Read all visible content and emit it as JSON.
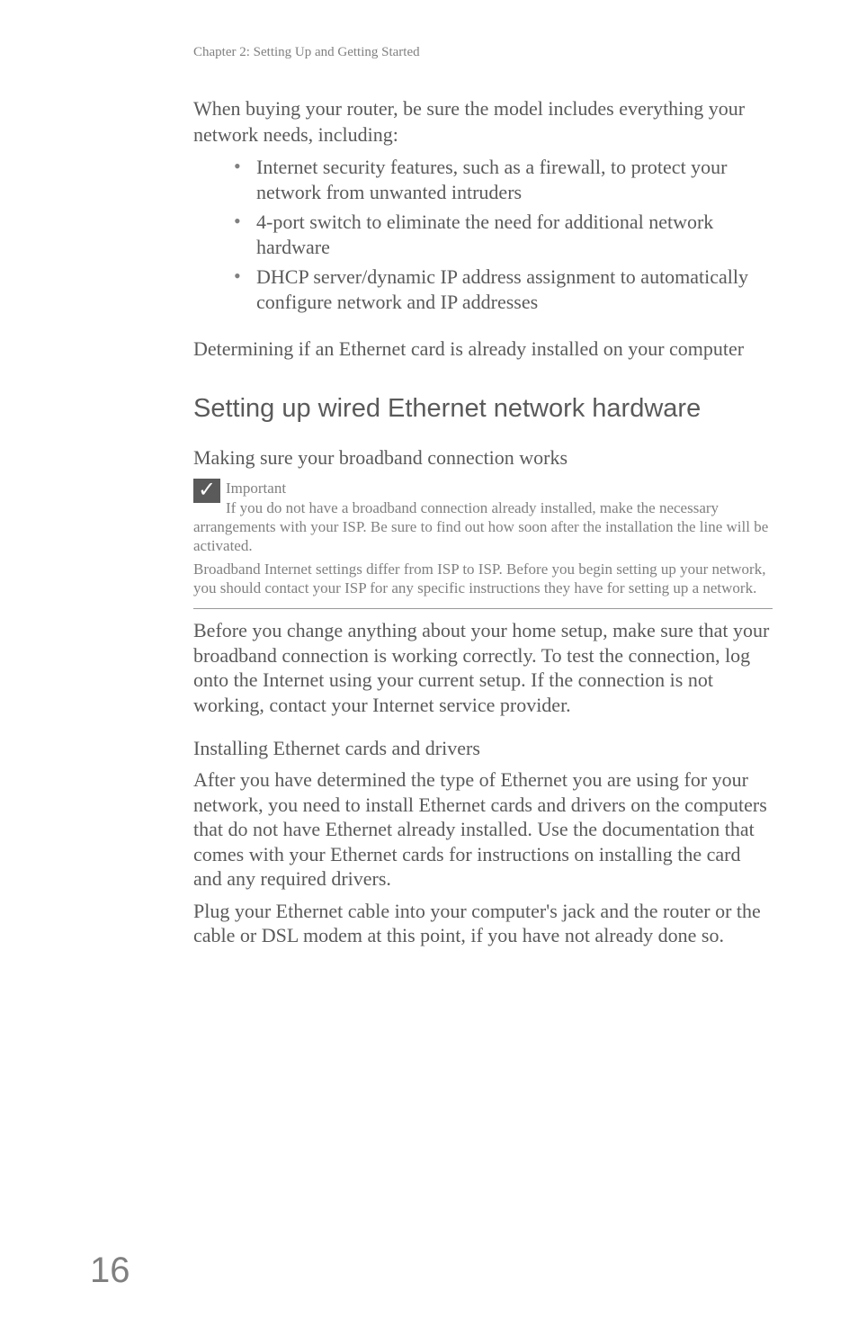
{
  "header": "Chapter 2: Setting Up and Getting Started",
  "intro": "When buying your router, be sure the model includes everything your network needs, including:",
  "bullets": [
    "Internet security features, such as a firewall, to protect your network from unwanted intruders",
    "4-port switch to eliminate the need for additional network hardware",
    "DHCP server/dynamic IP address assignment to automatically configure network and IP addresses"
  ],
  "subheading1": "Determining if an Ethernet card is already installed on your computer",
  "sectionHeading": "Setting up wired Ethernet network hardware",
  "subsection1": "Making sure your broadband connection works",
  "importantLabel": "Important",
  "importantText1": "If you do not have a broadband connection already installed, make the necessary arrangements with your ISP. Be sure to find out how soon after the installation the line will be activated.",
  "importantText2": "Broadband Internet settings differ from ISP to ISP. Before you begin setting up your network, you should contact your ISP for any specific instructions they have for setting up a network.",
  "bodyPara1": "Before you change anything about your home setup, make sure that your broadband connection is working correctly. To test the connection, log onto the Internet using your current setup. If the connection is not working, contact your Internet service provider.",
  "subsection2": "Installing Ethernet cards and drivers",
  "bodyPara2": "After you have determined the type of Ethernet you are using for your network, you need to install Ethernet cards and drivers on the computers that do not have Ethernet already installed. Use the documentation that comes with your Ethernet cards for instructions on installing the card and any required drivers.",
  "bodyPara3": "Plug your Ethernet cable into your computer's jack and the router or the cable or DSL modem at this point, if you have not already done so.",
  "pageNumber": "16"
}
